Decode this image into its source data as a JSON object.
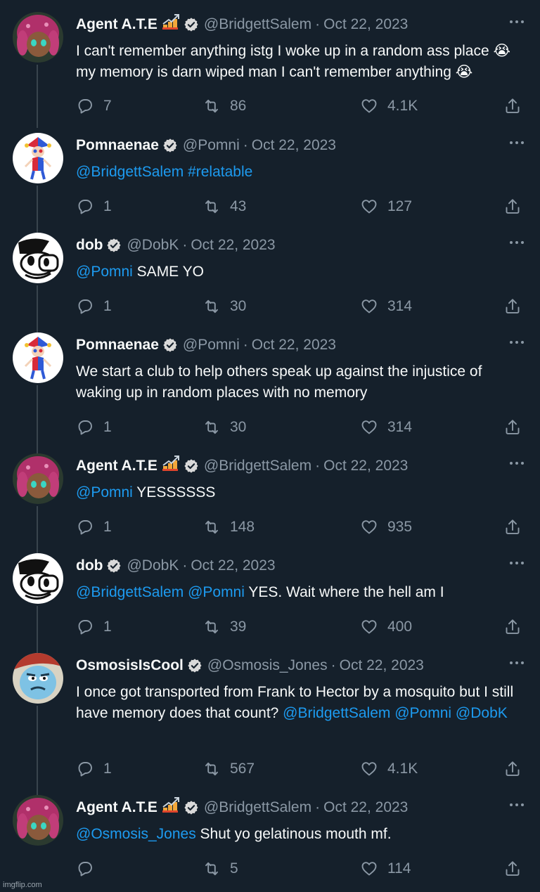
{
  "colors": {
    "background": "#15202b",
    "text": "#f7f9f9",
    "muted": "#8b98a5",
    "link": "#1d9bf0",
    "thread_line": "#38444d",
    "verified": "#d9d9d9"
  },
  "tweets": [
    {
      "name": "Agent A.T.E",
      "badge": "signal-graph-emoji",
      "avatar": "octoling-avatar",
      "handle": "@BridgettSalem",
      "separator": "·",
      "date": "Oct 22, 2023",
      "body": [
        {
          "text": "I can't remember anything istg I woke up in a random ass place "
        },
        {
          "text": "😭"
        },
        {
          "text": " my memory is darn wiped man I can't remember anything "
        },
        {
          "text": "😭"
        }
      ],
      "counts": {
        "reply": "7",
        "retweet": "86",
        "like": "4.1K"
      }
    },
    {
      "name": "Pomnaenae",
      "badge": "",
      "avatar": "jester-avatar",
      "handle": "@Pomni",
      "separator": "·",
      "date": "Oct 22, 2023",
      "body": [
        {
          "text": "@BridgettSalem",
          "link": true
        },
        {
          "text": " "
        },
        {
          "text": "#relatable",
          "link": true
        }
      ],
      "counts": {
        "reply": "1",
        "retweet": "43",
        "like": "127"
      }
    },
    {
      "name": "dob",
      "badge": "",
      "avatar": "cartoon-dog-avatar",
      "handle": "@DobK",
      "separator": "·",
      "date": "Oct 22, 2023",
      "body": [
        {
          "text": "@Pomni",
          "link": true
        },
        {
          "text": " SAME YO"
        }
      ],
      "counts": {
        "reply": "1",
        "retweet": "30",
        "like": "314"
      }
    },
    {
      "name": "Pomnaenae",
      "badge": "",
      "avatar": "jester-avatar",
      "handle": "@Pomni",
      "separator": "·",
      "date": "Oct 22, 2023",
      "body": [
        {
          "text": "We start a club to help others speak up against the injustice of waking up in random places with no memory"
        }
      ],
      "counts": {
        "reply": "1",
        "retweet": "30",
        "like": "314"
      }
    },
    {
      "name": "Agent A.T.E",
      "badge": "signal-graph-emoji",
      "avatar": "octoling-avatar",
      "handle": "@BridgettSalem",
      "separator": "·",
      "date": "Oct 22, 2023",
      "body": [
        {
          "text": "@Pomni",
          "link": true
        },
        {
          "text": " YESSSSSS"
        }
      ],
      "counts": {
        "reply": "1",
        "retweet": "148",
        "like": "935"
      }
    },
    {
      "name": "dob",
      "badge": "",
      "avatar": "cartoon-dog-avatar",
      "handle": "@DobK",
      "separator": "·",
      "date": "Oct 22, 2023",
      "body": [
        {
          "text": "@BridgettSalem",
          "link": true
        },
        {
          "text": " "
        },
        {
          "text": "@Pomni",
          "link": true
        },
        {
          "text": " YES. Wait where the hell am I"
        }
      ],
      "counts": {
        "reply": "1",
        "retweet": "39",
        "like": "400"
      }
    },
    {
      "name": "OsmosisIsCool",
      "badge": "",
      "avatar": "osmosis-avatar",
      "handle": "@Osmosis_Jones",
      "separator": "·",
      "date": "Oct 22, 2023",
      "body": [
        {
          "text": "I once got transported from Frank to Hector by a mosquito but I still have memory does that count? "
        },
        {
          "text": "@BridgettSalem",
          "link": true
        },
        {
          "text": " "
        },
        {
          "text": "@Pomni",
          "link": true
        },
        {
          "text": " "
        },
        {
          "text": "@DobK",
          "link": true
        }
      ],
      "counts": {
        "reply": "1",
        "retweet": "567",
        "like": "4.1K"
      }
    },
    {
      "name": "Agent A.T.E",
      "badge": "signal-graph-emoji",
      "avatar": "octoling-avatar",
      "handle": "@BridgettSalem",
      "separator": "·",
      "date": "Oct 22, 2023",
      "body": [
        {
          "text": "@Osmosis_Jones",
          "link": true
        },
        {
          "text": " Shut yo gelatinous mouth mf."
        }
      ],
      "counts": {
        "reply": "",
        "retweet": "5",
        "like": "114"
      }
    }
  ],
  "watermark": "imgflip.com"
}
